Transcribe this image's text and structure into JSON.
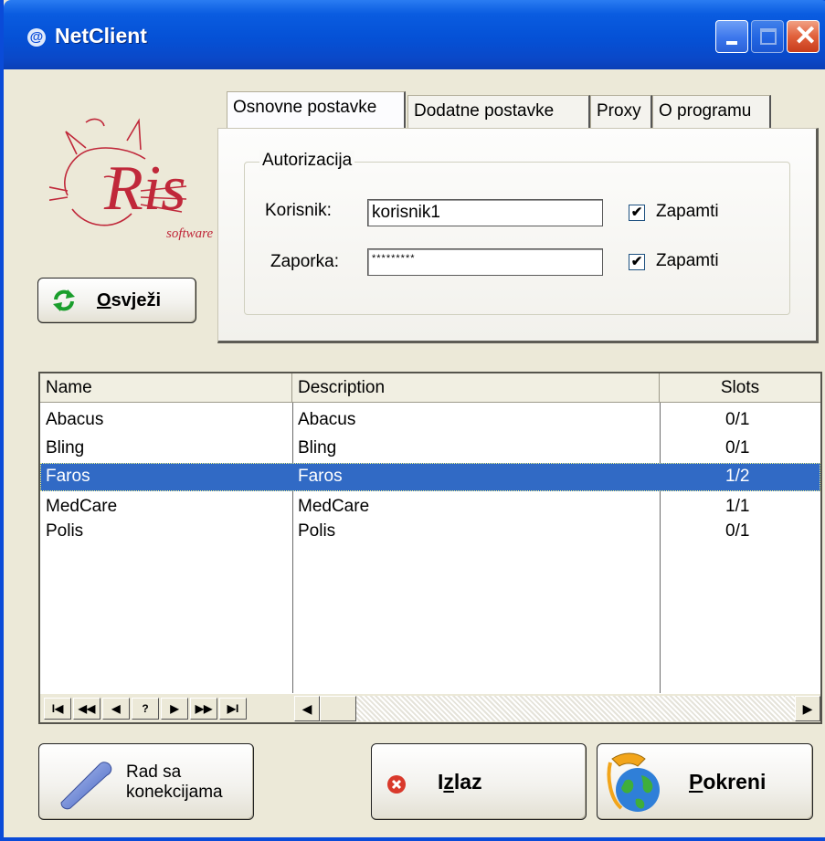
{
  "window": {
    "title": "NetClient"
  },
  "logo": {
    "text": "Ris",
    "subtext": "software"
  },
  "refresh_button": {
    "mnemonic": "O",
    "rest": "svježi"
  },
  "tabs": [
    {
      "label": "Osnovne postavke",
      "active": true
    },
    {
      "label": "Dodatne postavke",
      "active": false
    },
    {
      "label": "Proxy",
      "active": false
    },
    {
      "label": "O programu",
      "active": false
    }
  ],
  "auth": {
    "legend": "Autorizacija",
    "user_label": "Korisnik:",
    "user_value": "korisnik1",
    "user_remember_label": "Zapamti",
    "user_remember_checked": true,
    "pass_label": "Zaporka:",
    "pass_value": "*********",
    "pass_remember_label": "Zapamti",
    "pass_remember_checked": true
  },
  "grid": {
    "columns": [
      "Name",
      "Description",
      "Slots"
    ],
    "rows": [
      {
        "name": "Abacus",
        "description": "Abacus",
        "slots": "0/1",
        "selected": false
      },
      {
        "name": "Bling",
        "description": "Bling",
        "slots": "0/1",
        "selected": false
      },
      {
        "name": "Faros",
        "description": "Faros",
        "slots": "1/2",
        "selected": true
      },
      {
        "name": "MedCare",
        "description": "MedCare",
        "slots": "1/1",
        "selected": false
      },
      {
        "name": "Polis",
        "description": "Polis",
        "slots": "0/1",
        "selected": false
      }
    ],
    "nav_buttons": [
      "I◀",
      "◀◀",
      "◀",
      "?",
      "▶",
      "▶▶",
      "▶I"
    ]
  },
  "buttons": {
    "connections_line1": "Rad sa",
    "connections_line2": "konekcijama",
    "exit_mnemonic": "z",
    "exit_pre": "I",
    "exit_post": "laz",
    "run_mnemonic": "P",
    "run_rest": "okreni"
  },
  "colors": {
    "titlebar": "#0a4bd8",
    "selection": "#316ac5",
    "logo": "#c0283a",
    "exit_icon": "#d9392b"
  }
}
